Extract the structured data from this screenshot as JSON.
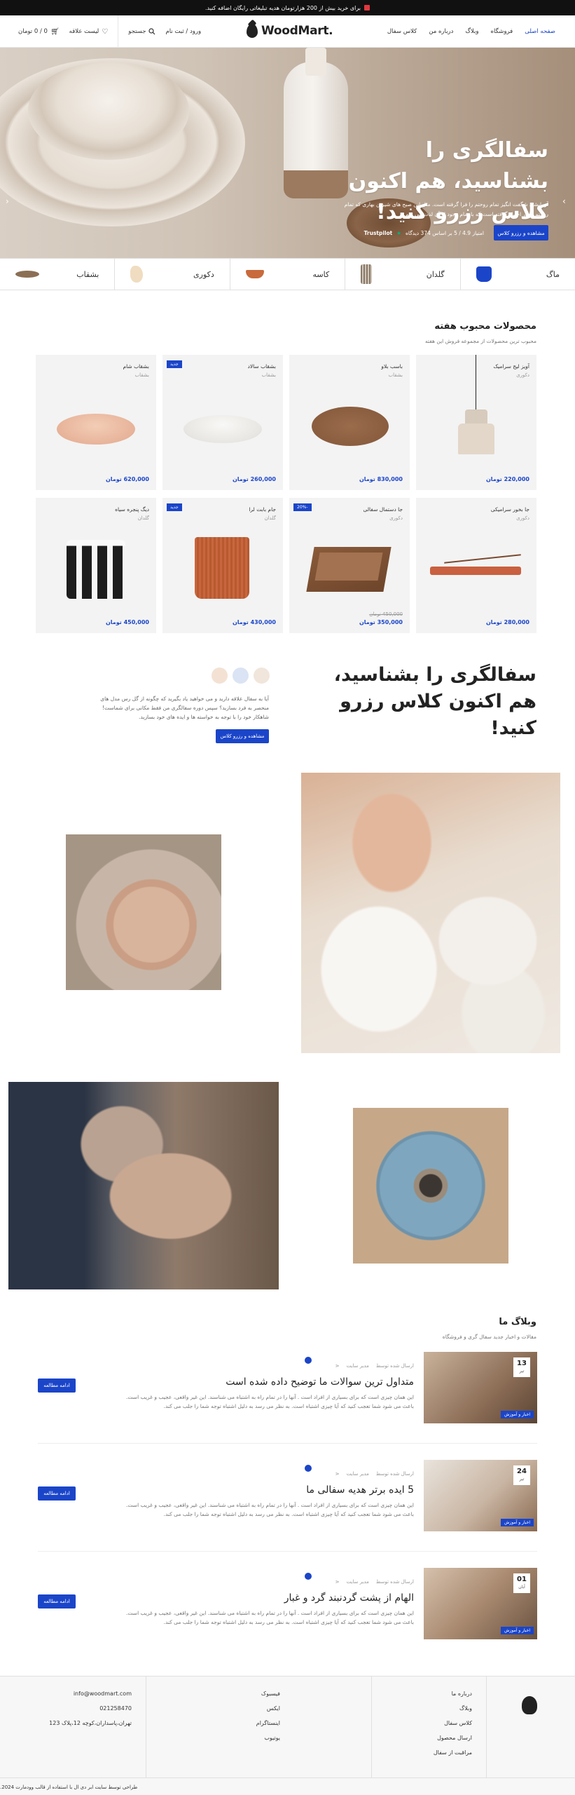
{
  "topbar": {
    "text": "برای خرید بیش از 200 هزارتومان هدیه تبلیغاتی رایگان اضافه کنید."
  },
  "header": {
    "nav": [
      "صفحه اصلی",
      "فروشگاه",
      "وبلاگ",
      "درباره من",
      "کلاس سفال"
    ],
    "logo": "WoodMart.",
    "login": "ورود / ثبت نام",
    "search": "جستجو",
    "wishlist": "لیست علاقه",
    "cart": "0 / 0 تومان"
  },
  "hero": {
    "title": "سفالگری را بشناسید، هم اکنون کلاس رزرو کنید!",
    "subtitle": "آزمایشی شگفت انگیز تمام روحتم را فرا گرفته است. مثل این صبح های شیرین بهاری که تمام روحتم را در اختیار گرفته است که با تمام وجود از آن لذت می برم.",
    "button": "مشاهده و رزرو کلاس",
    "rating": "امتیاز 4.9 / 5 بر اساس 374 دیدگاه",
    "trustpilot": "Trustpilot"
  },
  "categories": [
    {
      "label": "ماگ",
      "icon": "mug-icon",
      "color": "#1b45c9"
    },
    {
      "label": "گلدان",
      "icon": "vase-icon",
      "color": "#8a7a6a"
    },
    {
      "label": "کاسه",
      "icon": "bowl-icon",
      "color": "#c86a3c"
    },
    {
      "label": "دکوری",
      "icon": "decor-icon",
      "color": "#e6c79a"
    },
    {
      "label": "بشقاب",
      "icon": "plate-icon",
      "color": "#8b6f55"
    }
  ],
  "weekly": {
    "title": "محصولات محبوب هفته",
    "subtitle": "محبوب ترین محصولات از مجموعه فروش این هفته"
  },
  "products": [
    {
      "name": "آویز لیج سرامیک",
      "cat": "دکوری",
      "price": "220,000 تومان",
      "badge": ""
    },
    {
      "name": "باسب بلاو",
      "cat": "بشقاب",
      "price": "830,000 تومان",
      "badge": ""
    },
    {
      "name": "بشقاب سالاد",
      "cat": "بشقاب",
      "price": "260,000 تومان",
      "badge": "جدید"
    },
    {
      "name": "بشقاب شام",
      "cat": "بشقاب",
      "price": "620,000 تومان",
      "badge": ""
    },
    {
      "name": "جا بخور سرامیکی",
      "cat": "دکوری",
      "price": "280,000 تومان",
      "badge": ""
    },
    {
      "name": "جا دستمال سفالی",
      "cat": "دکوری",
      "price": "350,000 تومان",
      "badge": "-20%",
      "old": "450,000 تومان"
    },
    {
      "name": "جام بابت لرا",
      "cat": "گلدان",
      "price": "430,000 تومان",
      "badge": "جدید"
    },
    {
      "name": "دیگ پنجره سیاه",
      "cat": "گلدان",
      "price": "450,000 تومان",
      "badge": ""
    }
  ],
  "class_section": {
    "title": "سفالگری را بشناسید، هم اکنون کلاس رزرو کنید!",
    "text": "آیا به سفال علاقه دارید و می خواهید یاد بگیرید که چگونه از گل رس مدل های منحصر به فرد بسازید؟ سپس دوره سفالگری من فقط مکانی برای شماست! شاهکار خود را با توجه به خواسته ها و ایده های خود بسازید.",
    "button": "مشاهده و رزرو کلاس"
  },
  "blog": {
    "title": "وبلاگ ما",
    "subtitle": "مقالات و اخبار جدید سفال گری و فروشگاه",
    "posts": [
      {
        "day": "13",
        "month": "تیر",
        "tag": "اخبار و آموزش",
        "author": "ارسال شده توسط",
        "admin": "مدیر سایت",
        "title": "متداول ترین سوالات ما توضیح داده شده است",
        "excerpt": "این همان چیزی است که برای بسیاری از افراد است . آنها را در تمام راه به اشتباه می شناسند. این غیر واقعی، عجیب و غریب است. باعث می شود شما تعجب کنید که آیا چیزی اشتباه است. به نظر می رسد به دلیل اشتباه توجه شما را جلب می کند.",
        "button": "ادامه مطالعه"
      },
      {
        "day": "24",
        "month": "تیر",
        "tag": "اخبار و آموزش",
        "author": "ارسال شده توسط",
        "admin": "مدیر سایت",
        "title": "5 ایده برتر هدیه سفالی ما",
        "excerpt": "این همان چیزی است که برای بسیاری از افراد است . آنها را در تمام راه به اشتباه می شناسند. این غیر واقعی، عجیب و غریب است. باعث می شود شما تعجب کنید که آیا چیزی اشتباه است. به نظر می رسد به دلیل اشتباه توجه شما را جلب می کند.",
        "button": "ادامه مطالعه"
      },
      {
        "day": "01",
        "month": "آبان",
        "tag": "اخبار و آموزش",
        "author": "ارسال شده توسط",
        "admin": "مدیر سایت",
        "title": "الهام از پشت گردنبند گرد و غبار",
        "excerpt": "این همان چیزی است که برای بسیاری از افراد است . آنها را در تمام راه به اشتباه می شناسند. این غیر واقعی، عجیب و غریب است. باعث می شود شما تعجب کنید که آیا چیزی اشتباه است. به نظر می رسد به دلیل اشتباه توجه شما را جلب می کند.",
        "button": "ادامه مطالعه"
      }
    ]
  },
  "footer": {
    "links1": [
      "درباره ما",
      "وبلاگ",
      "کلاس سفال",
      "ارسال محصول",
      "مراقبت از سفال"
    ],
    "links2": [
      "فیسبوک",
      "ایکس",
      "اینستاگرام",
      "یوتیوب"
    ],
    "contact": [
      "info@woodmart.com",
      "021258470",
      "تهران،پاسداران،کوچه 12،پلاک 123"
    ],
    "copyright": "طراحی توسط سایت ابر دی ال با استفاده از قالب وودمارت 2024."
  },
  "colors": {
    "accent": "#1b45c9",
    "topbar": "#111111"
  }
}
